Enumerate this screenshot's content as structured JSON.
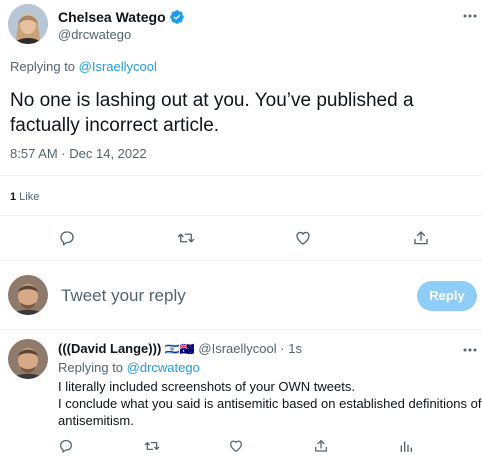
{
  "tweet": {
    "author_name": "Chelsea Watego",
    "author_handle": "@drcwatego",
    "replying_prefix": "Replying to ",
    "replying_to": "@Israellycool",
    "text": "No one is lashing out at you. You’ve published a factually incorrect article.",
    "timestamp": "8:57 AM · Dec 14, 2022",
    "likes_count": "1",
    "likes_label": " Like"
  },
  "composer": {
    "placeholder": "Tweet your reply",
    "reply_button": "Reply"
  },
  "reply": {
    "author_name": "(((David Lange)))",
    "flags": "🇮🇱🇦🇺",
    "author_handle": "@Israellycool",
    "separator": " · ",
    "time": "1s",
    "replying_prefix": "Replying to ",
    "replying_to": "@drcwatego",
    "line1": "I literally included screenshots of your OWN tweets.",
    "line2": "I conclude what you said is antisemitic based on established definitions of",
    "line3": "antisemitism."
  },
  "colors": {
    "accent": "#1d9bf0",
    "muted": "#536471",
    "divider": "#eff3f4",
    "reply_button_disabled": "#8ecdf8"
  },
  "icons": [
    "verified-badge-icon",
    "more-icon",
    "reply-icon",
    "retweet-icon",
    "like-icon",
    "share-icon",
    "analytics-icon"
  ]
}
